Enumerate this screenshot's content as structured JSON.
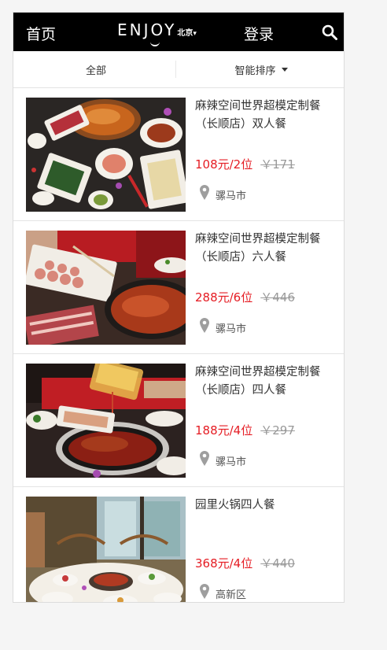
{
  "header": {
    "home_label": "首页",
    "logo_text": "ENJOY",
    "city": "北京",
    "city_caret": "▾",
    "login_label": "登录",
    "search_icon": "search-icon",
    "background": "#000000"
  },
  "filters": {
    "category_label": "全部",
    "sort_label": "智能排序"
  },
  "accent_color": "#e51c23",
  "items": [
    {
      "title": "麻辣空间世界超模定制餐（长顺店）双人餐",
      "price": "108元/2位",
      "original_price": "￥171",
      "location": "骡马市"
    },
    {
      "title": "麻辣空间世界超模定制餐（长顺店）六人餐",
      "price": "288元/6位",
      "original_price": "￥446",
      "location": "骡马市"
    },
    {
      "title": "麻辣空间世界超模定制餐（长顺店）四人餐",
      "price": "188元/4位",
      "original_price": "￥297",
      "location": "骡马市"
    },
    {
      "title": "园里火锅四人餐",
      "price": "368元/4位",
      "original_price": "￥440",
      "location": "高新区"
    }
  ]
}
